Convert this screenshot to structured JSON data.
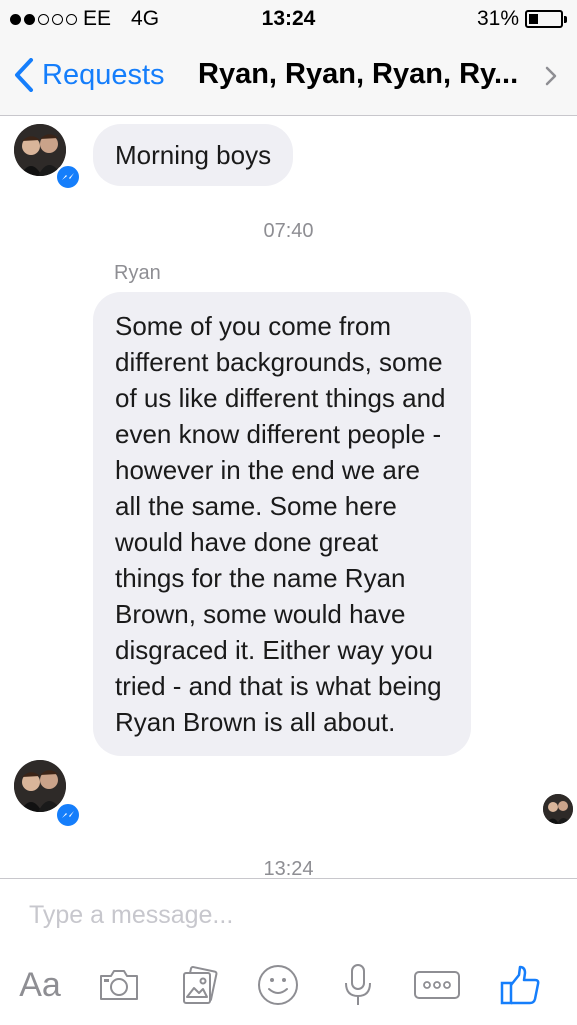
{
  "status_bar": {
    "carrier": "EE",
    "network": "4G",
    "time": "13:24",
    "battery": "31%"
  },
  "nav": {
    "back_label": "Requests",
    "title": "Ryan, Ryan, Ryan, Ry..."
  },
  "messages": [
    {
      "text": "Morning boys"
    },
    {
      "timestamp": "07:40"
    },
    {
      "sender": "Ryan",
      "text": "Some of you come from different backgrounds, some of us like different things and even know different people - however in the end we are all the same. Some here would have done great things for the name Ryan Brown, some would have disgraced it. Either way you tried - and that is what being Ryan Brown is all about."
    },
    {
      "timestamp": "13:24"
    }
  ],
  "composer": {
    "placeholder": "Type a message...",
    "text_button": "Aa"
  },
  "colors": {
    "accent": "#157efb",
    "bubble": "#efeff4",
    "muted": "#8e8e93"
  }
}
